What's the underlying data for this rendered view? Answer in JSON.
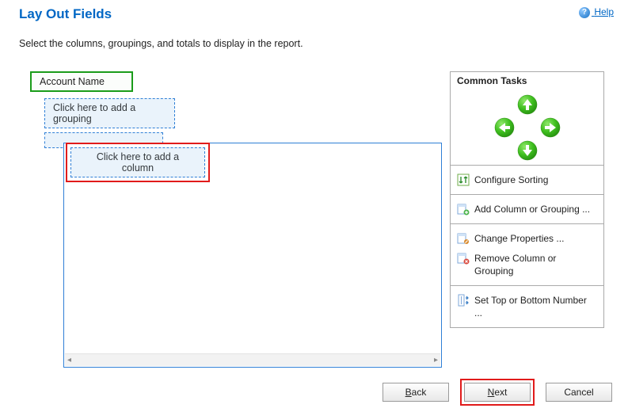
{
  "header": {
    "title": "Lay Out Fields",
    "help_label": "Help"
  },
  "instruction": "Select the columns, groupings, and totals to display in the report.",
  "fields": {
    "account_name": "Account Name",
    "add_grouping": "Click here to add a grouping",
    "add_column": "Click here to add a column"
  },
  "tasks": {
    "title": "Common Tasks",
    "configure_sorting": "Configure Sorting",
    "add_column_grouping": "Add Column or Grouping ...",
    "change_properties": "Change Properties ...",
    "remove_column_grouping": "Remove Column or Grouping",
    "set_top_bottom": "Set Top or Bottom Number ..."
  },
  "buttons": {
    "back": "Back",
    "next": "Next",
    "cancel": "Cancel"
  }
}
